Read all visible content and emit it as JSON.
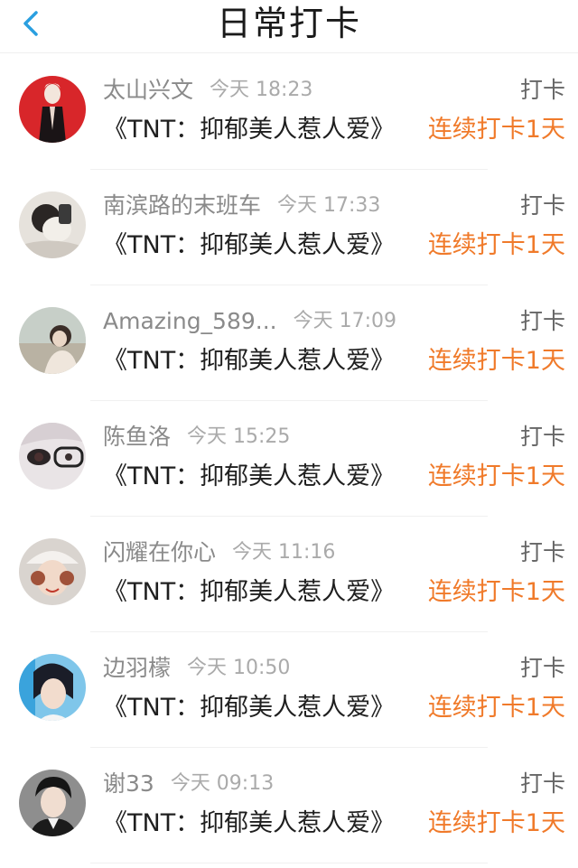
{
  "header": {
    "title": "日常打卡",
    "back_icon": "chevron-left-icon",
    "accent_color": "#2a9fe0"
  },
  "colors": {
    "name": "#8a8a8a",
    "time": "#aaaaaa",
    "book": "#1f1f1f",
    "streak": "#f07a2a"
  },
  "records": [
    {
      "name": "太山兴文",
      "time": "今天 18:23",
      "action": "打卡",
      "book": "《TNT：抑郁美人惹人爱》",
      "streak": "连续打卡1天"
    },
    {
      "name": "南滨路的末班车",
      "time": "今天 17:33",
      "action": "打卡",
      "book": "《TNT：抑郁美人惹人爱》",
      "streak": "连续打卡1天"
    },
    {
      "name": "Amazing_589...",
      "time": "今天 17:09",
      "action": "打卡",
      "book": "《TNT：抑郁美人惹人爱》",
      "streak": "连续打卡1天"
    },
    {
      "name": "陈鱼洛",
      "time": "今天 15:25",
      "action": "打卡",
      "book": "《TNT：抑郁美人惹人爱》",
      "streak": "连续打卡1天"
    },
    {
      "name": "闪耀在你心",
      "time": "今天 11:16",
      "action": "打卡",
      "book": "《TNT：抑郁美人惹人爱》",
      "streak": "连续打卡1天"
    },
    {
      "name": "边羽檬",
      "time": "今天 10:50",
      "action": "打卡",
      "book": "《TNT：抑郁美人惹人爱》",
      "streak": "连续打卡1天"
    },
    {
      "name": "谢33",
      "time": "今天 09:13",
      "action": "打卡",
      "book": "《TNT：抑郁美人惹人爱》",
      "streak": "连续打卡1天"
    }
  ]
}
